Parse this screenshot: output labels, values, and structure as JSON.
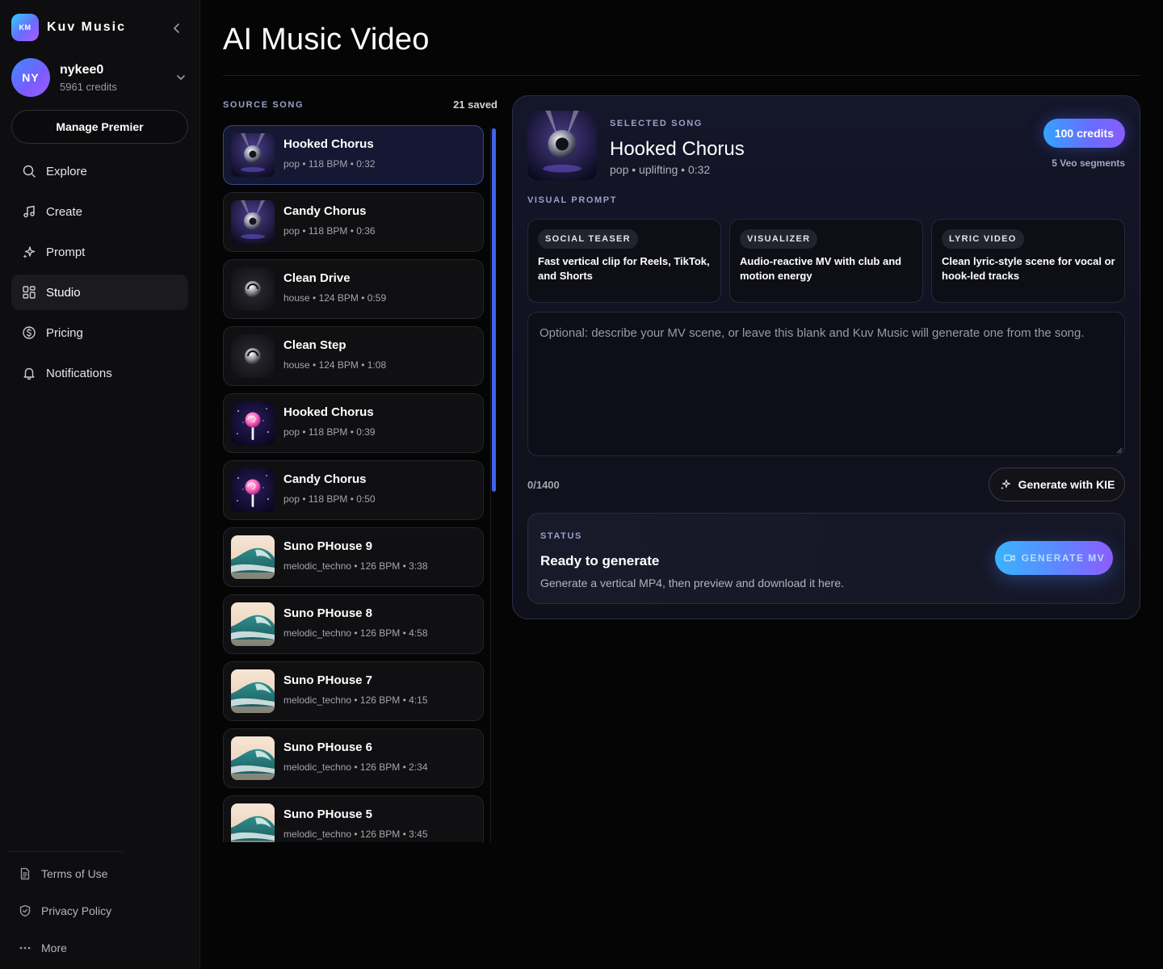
{
  "brand": {
    "logo_text": "KM",
    "name": "Kuv Music"
  },
  "user": {
    "initials": "NY",
    "name": "nykee0",
    "credits": "5961 credits"
  },
  "sidebar": {
    "manage_label": "Manage Premier",
    "nav": [
      {
        "label": "Explore",
        "icon": "search-icon"
      },
      {
        "label": "Create",
        "icon": "music-note-icon"
      },
      {
        "label": "Prompt",
        "icon": "sparkle-icon"
      },
      {
        "label": "Studio",
        "icon": "grid-icon",
        "active": true
      },
      {
        "label": "Pricing",
        "icon": "dollar-circle-icon"
      },
      {
        "label": "Notifications",
        "icon": "bell-icon"
      }
    ],
    "footer": [
      {
        "label": "Terms of Use",
        "icon": "document-icon"
      },
      {
        "label": "Privacy Policy",
        "icon": "shield-icon"
      },
      {
        "label": "More",
        "icon": "ellipsis-icon"
      }
    ]
  },
  "page": {
    "title": "AI Music Video"
  },
  "source": {
    "label": "SOURCE SONG",
    "saved": "21 saved",
    "songs": [
      {
        "title": "Hooked Chorus",
        "meta": "pop • 118 BPM • 0:32",
        "thumb": "disco-ball"
      },
      {
        "title": "Candy Chorus",
        "meta": "pop • 118 BPM • 0:36",
        "thumb": "disco-ball"
      },
      {
        "title": "Clean Drive",
        "meta": "house • 124 BPM • 0:59",
        "thumb": "orb"
      },
      {
        "title": "Clean Step",
        "meta": "house • 124 BPM • 1:08",
        "thumb": "orb"
      },
      {
        "title": "Hooked Chorus",
        "meta": "pop • 118 BPM • 0:39",
        "thumb": "lollipop"
      },
      {
        "title": "Candy Chorus",
        "meta": "pop • 118 BPM • 0:50",
        "thumb": "lollipop"
      },
      {
        "title": "Suno PHouse 9",
        "meta": "melodic_techno • 126 BPM • 3:38",
        "thumb": "wave"
      },
      {
        "title": "Suno PHouse 8",
        "meta": "melodic_techno • 126 BPM • 4:58",
        "thumb": "wave"
      },
      {
        "title": "Suno PHouse 7",
        "meta": "melodic_techno • 126 BPM • 4:15",
        "thumb": "wave"
      },
      {
        "title": "Suno PHouse 6",
        "meta": "melodic_techno • 126 BPM • 2:34",
        "thumb": "wave"
      },
      {
        "title": "Suno PHouse 5",
        "meta": "melodic_techno • 126 BPM • 3:45",
        "thumb": "wave"
      }
    ]
  },
  "selected": {
    "label": "SELECTED SONG",
    "title": "Hooked Chorus",
    "meta": "pop • uplifting • 0:32",
    "credits": "100 credits",
    "segments": "5 Veo segments"
  },
  "visual_prompt": {
    "label": "VISUAL PROMPT",
    "presets": [
      {
        "tag": "SOCIAL TEASER",
        "desc": "Fast vertical clip for Reels, TikTok, and Shorts"
      },
      {
        "tag": "VISUALIZER",
        "desc": "Audio-reactive MV with club and motion energy"
      },
      {
        "tag": "LYRIC VIDEO",
        "desc": "Clean lyric-style scene for vocal or hook-led tracks"
      }
    ],
    "placeholder": "Optional: describe your MV scene, or leave this blank and Kuv Music will generate one from the song.",
    "value": "",
    "char_count": "0/1400",
    "kie_label": "Generate with KIE"
  },
  "status": {
    "label": "STATUS",
    "title": "Ready to generate",
    "desc": "Generate a vertical MP4, then preview and download it here.",
    "generate_label": "GENERATE MV"
  },
  "colors": {
    "accent": "#6a6cff",
    "scroll": "#3f63e8",
    "panel_border": "#2a2e48"
  }
}
